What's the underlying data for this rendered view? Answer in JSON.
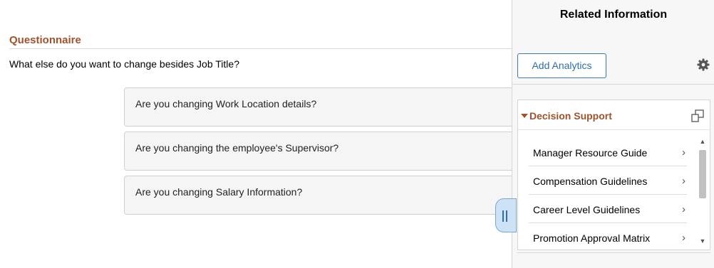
{
  "questionnaire": {
    "title": "Questionnaire",
    "prompt": "What else do you want to change besides Job Title?",
    "options": [
      "Are you changing Work Location details?",
      "Are you changing the employee's Supervisor?",
      "Are you changing Salary Information?"
    ]
  },
  "panel": {
    "title": "Related Information",
    "add_analytics_label": "Add Analytics",
    "gear_icon": "gear-icon",
    "decision_support": {
      "title": "Decision Support",
      "items": [
        "Manager Resource Guide",
        "Compensation Guidelines",
        "Career Level Guidelines",
        "Promotion Approval Matrix"
      ],
      "chevron": "›"
    }
  },
  "colors": {
    "section_title": "#a0522d",
    "link_blue": "#2f6fa8",
    "panel_bg": "#f7f7f7"
  }
}
